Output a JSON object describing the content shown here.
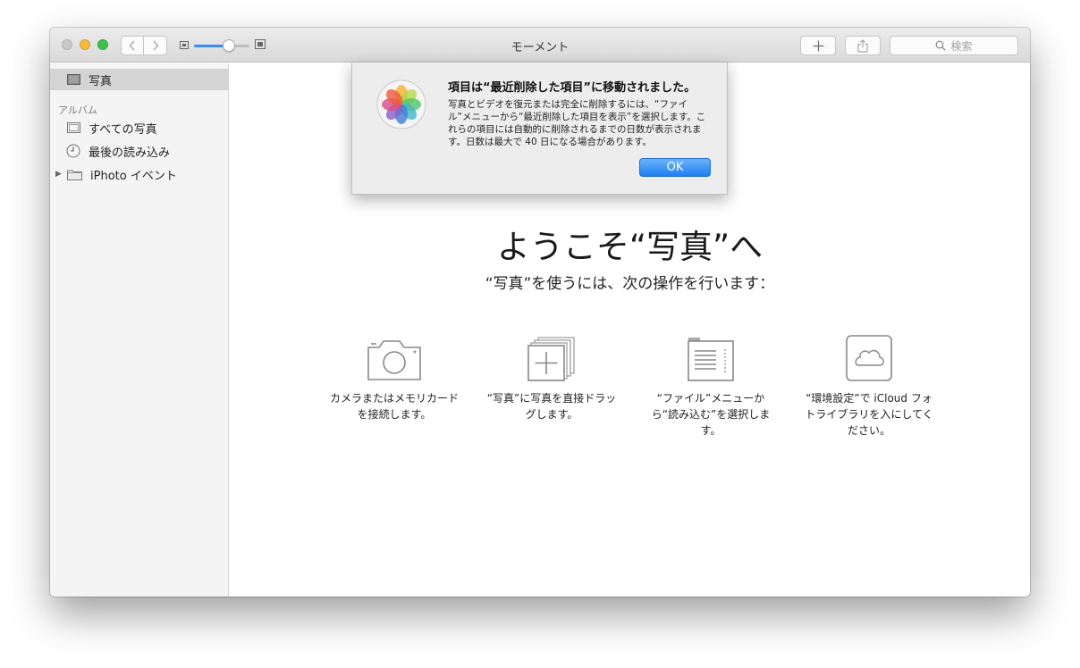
{
  "window": {
    "title": "モーメント",
    "search_placeholder": "検索"
  },
  "sidebar": {
    "photos_label": "写真",
    "album_header": "アルバム",
    "items": [
      {
        "label": "すべての写真"
      },
      {
        "label": "最後の読み込み"
      },
      {
        "label": "iPhoto イベント"
      }
    ]
  },
  "main": {
    "welcome": "ようこそ“写真”へ",
    "subtitle": "“写真”を使うには、次の操作を行います：",
    "options": [
      {
        "icon": "camera-icon",
        "text": "カメラまたはメモリカードを接続します。"
      },
      {
        "icon": "photo-stack-add-icon",
        "text": "“写真”に写真を直接ドラッグします。"
      },
      {
        "icon": "file-menu-icon",
        "text": "“ファイル”メニューから“読み込む”を選択します。"
      },
      {
        "icon": "icloud-icon",
        "text": "“環境設定”で iCloud フォトライブラリを入にしてください。"
      }
    ]
  },
  "alert": {
    "title": "項目は“最近削除した項目”に移動されました。",
    "message": "写真とビデオを復元または完全に削除するには、“ファイル”メニューから“最近削除した項目を表示”を選択します。これらの項目には自動的に削除されるまでの日数が表示されます。日数は最大で 40 日になる場合があります。",
    "ok_label": "OK"
  },
  "colors": {
    "accent": "#1d7ff0",
    "close": "#c9c9c9",
    "minimize": "#f5b93b",
    "maximize": "#3dc24b"
  }
}
